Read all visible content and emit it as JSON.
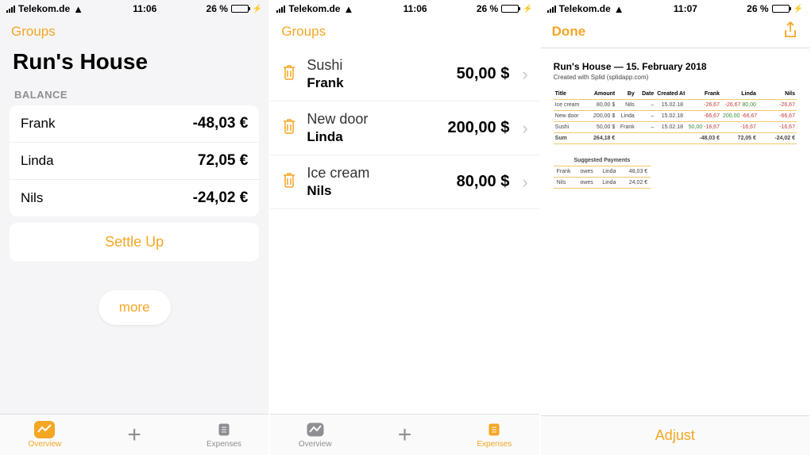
{
  "status": {
    "carrier": "Telekom.de",
    "time1": "11:06",
    "time2": "11:06",
    "time3": "11:07",
    "battery": "26 %"
  },
  "screen1": {
    "nav": "Groups",
    "title": "Run's House",
    "section": "BALANCE",
    "balances": [
      {
        "name": "Frank",
        "amount": "-48,03 €"
      },
      {
        "name": "Linda",
        "amount": "72,05 €"
      },
      {
        "name": "Nils",
        "amount": "-24,02 €"
      }
    ],
    "settle": "Settle Up",
    "more": "more",
    "tabs": {
      "overview": "Overview",
      "expenses": "Expenses"
    }
  },
  "screen2": {
    "nav": "Groups",
    "expenses": [
      {
        "title": "Sushi",
        "payer": "Frank",
        "amount": "50,00 $"
      },
      {
        "title": "New door",
        "payer": "Linda",
        "amount": "200,00 $"
      },
      {
        "title": "Ice cream",
        "payer": "Nils",
        "amount": "80,00 $"
      }
    ],
    "tabs": {
      "overview": "Overview",
      "expenses": "Expenses"
    }
  },
  "screen3": {
    "done": "Done",
    "adjust": "Adjust",
    "report": {
      "title": "Run's House — 15. February 2018",
      "subtitle": "Created with Splid (splidapp.com)",
      "headers": [
        "Title",
        "Amount",
        "By",
        "Date",
        "Created At",
        "Frank",
        "Linda",
        "Nils"
      ],
      "rows": [
        {
          "c": [
            "Ice cream",
            "80,00 $",
            "Nils",
            "–",
            "15.02.18",
            "-26,67",
            "-26,67",
            "80,00",
            "-26,67"
          ]
        },
        {
          "c": [
            "New door",
            "200,00 $",
            "Linda",
            "–",
            "15.02.18",
            "-66,67",
            "200,00",
            "-66,67",
            "-66,67"
          ]
        },
        {
          "c": [
            "Sushi",
            "50,00 $",
            "Frank",
            "–",
            "15.02.18",
            "50,00",
            "-16,67",
            "-16,67",
            "-16,67"
          ]
        }
      ],
      "sum": [
        "Sum",
        "264,18 €",
        "",
        "",
        "",
        "-48,03 €",
        "72,05 €",
        "-24,02 €"
      ],
      "suggested_hdr": "Suggested Payments",
      "suggested": [
        [
          "Frank",
          "owes",
          "Linda",
          "48,03 €"
        ],
        [
          "Nils",
          "owes",
          "Linda",
          "24,02 €"
        ]
      ]
    }
  }
}
